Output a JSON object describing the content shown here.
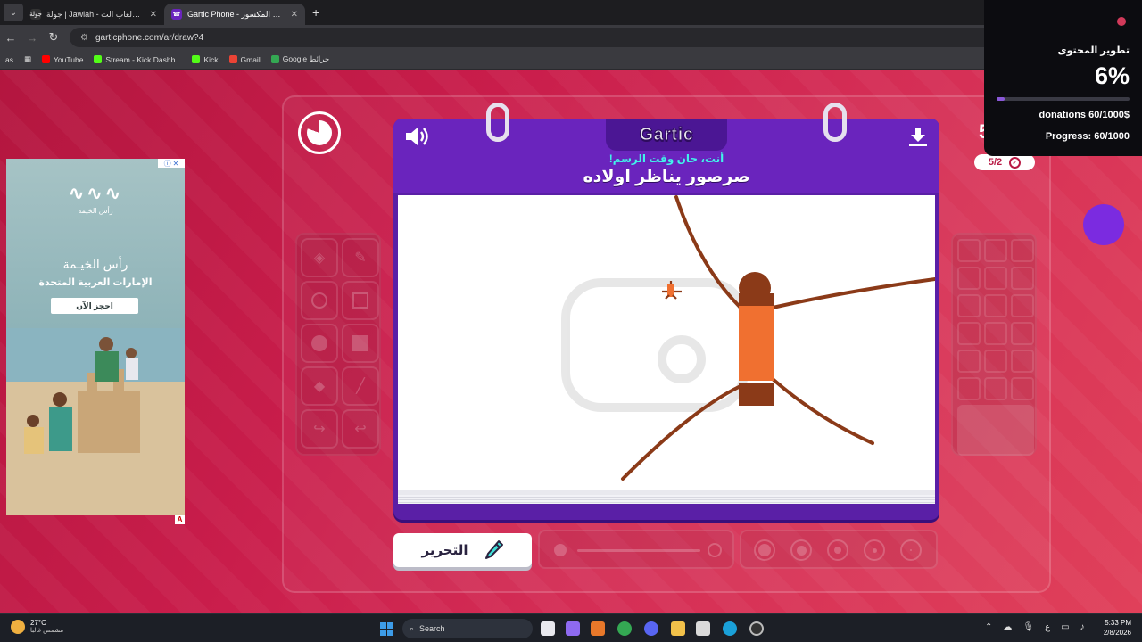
{
  "browser": {
    "tabs": [
      {
        "title": "جولة | Jawlah - منصة الألعاب الت",
        "favicon_label": "جولة",
        "active": false
      },
      {
        "title": "Gartic Phone - الهاتف المكسور",
        "favicon_label": "☎",
        "active": true
      }
    ],
    "new_tab_symbol": "+",
    "close_symbol": "✕",
    "url": "garticphone.com/ar/draw?4",
    "bookmarks": [
      {
        "label": "YouTube",
        "color": "#ff0000"
      },
      {
        "label": "Stream - Kick Dashb...",
        "color": "#53fc18"
      },
      {
        "label": "Kick",
        "color": "#53fc18"
      },
      {
        "label": "Gmail",
        "color": "#ea4335"
      },
      {
        "label": "Google خرائط",
        "color": "#34a853"
      }
    ],
    "profile_badge": "as"
  },
  "game": {
    "logo": "Gartic",
    "prompt_header": "أنت، حان وقت الرسم!",
    "word": "صرصور يناظر اولاده",
    "edit_button_label": "التحرير",
    "round_progress": "5/2",
    "side_number": "5",
    "timer_remaining_fraction": 0.8,
    "colors": {
      "page_bg": "#c91d4b",
      "card_purple": "#5a1fa6",
      "accent_cyan": "#41f2ea",
      "drawing_brown": "#8b3a18",
      "drawing_orange": "#f07030"
    }
  },
  "ad": {
    "brand": "رأس الخيمة",
    "headline": "رأس الخيـمة",
    "subheadline": "الإمارات العربية المتحدة",
    "cta": "احجز الآن",
    "badge": "A"
  },
  "overlay": {
    "title": "تطوير المحتوى",
    "percent": "6%",
    "percent_value": 6,
    "donations": "donations 60/1000$",
    "progress": "Progress: 60/1000"
  },
  "taskbar": {
    "temperature": "27°C",
    "weather_text": "مشمس غالبا",
    "search_label": "Search",
    "time": "5:33 PM",
    "date": "2/8/2026",
    "input_lang": "ع"
  }
}
